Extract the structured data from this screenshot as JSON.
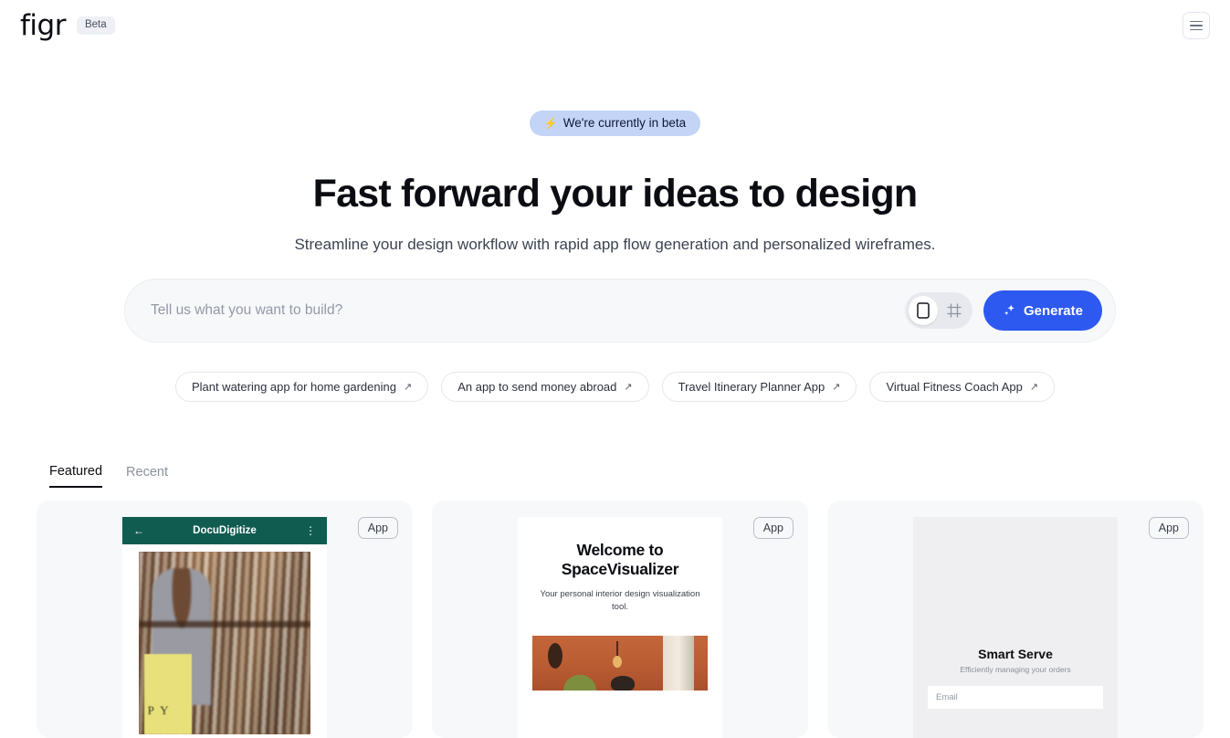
{
  "topbar": {
    "logo": "figr",
    "beta_badge": "Beta",
    "menu_icon": "hamburger-menu-icon"
  },
  "hero": {
    "beta_pill": "We're currently in beta",
    "beta_pill_icon": "lightning-bolt-icon",
    "headline": "Fast forward your ideas to design",
    "subheadline": "Streamline your design workflow with rapid app flow generation and personalized wireframes."
  },
  "prompt": {
    "placeholder": "Tell us what you want to build?",
    "value": "",
    "toggle": {
      "options": [
        {
          "name": "mobile-view",
          "icon": "phone-icon",
          "active": true
        },
        {
          "name": "frame-view",
          "icon": "frame-icon",
          "active": false
        }
      ]
    },
    "generate_label": "Generate",
    "generate_icon": "sparkles-icon",
    "generate_color": "#2d59f0"
  },
  "suggestions": [
    {
      "label": "Plant watering app for home gardening",
      "icon": "arrow-up-right-icon"
    },
    {
      "label": "An app to send money abroad",
      "icon": "arrow-up-right-icon"
    },
    {
      "label": "Travel Itinerary Planner App",
      "icon": "arrow-up-right-icon"
    },
    {
      "label": "Virtual Fitness Coach App",
      "icon": "arrow-up-right-icon"
    }
  ],
  "tabs": [
    {
      "label": "Featured",
      "active": true
    },
    {
      "label": "Recent",
      "active": false
    }
  ],
  "gallery": [
    {
      "badge": "App",
      "appbar_title": "DocuDigitize",
      "appbar_back_icon": "arrow-left-icon",
      "appbar_menu_icon": "kebab-menu-icon",
      "appbar_color": "#115c51",
      "book_text": "P Y"
    },
    {
      "badge": "App",
      "title": "Welcome to SpaceVisualizer",
      "subtitle": "Your personal interior design visualization tool."
    },
    {
      "badge": "App",
      "title": "Smart Serve",
      "subtitle": "Efficiently managing your orders",
      "email_placeholder": "Email"
    }
  ]
}
